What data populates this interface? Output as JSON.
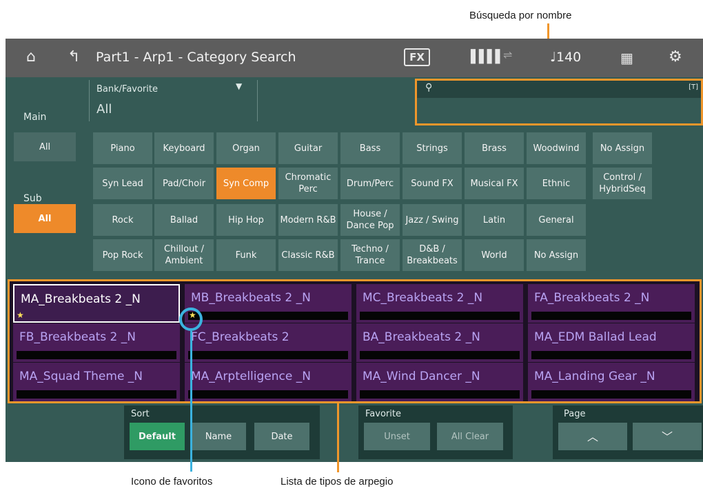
{
  "header": {
    "title": "Part1 - Arp1 - Category Search",
    "fx_label": "FX",
    "tempo_label": "♩140",
    "home_icon": "home-icon",
    "back_icon": "back-arrow-icon"
  },
  "bank": {
    "label": "Bank/Favorite",
    "value": "All"
  },
  "search": {
    "icon": "search-icon",
    "keyboard_indicator": "[T]",
    "value": ""
  },
  "main": {
    "label": "Main",
    "all_label": "All",
    "categories": [
      "Piano",
      "Keyboard",
      "Organ",
      "Guitar",
      "Bass",
      "Strings",
      "Brass",
      "Woodwind",
      "No Assign",
      "Syn Lead",
      "Pad/Choir",
      "Syn Comp",
      "Chromatic Perc",
      "Drum/Perc",
      "Sound FX",
      "Musical FX",
      "Ethnic",
      "Control / HybridSeq"
    ]
  },
  "sub": {
    "label": "Sub",
    "all_label": "All",
    "categories": [
      "Rock",
      "Ballad",
      "Hip Hop",
      "Modern R&B",
      "House / Dance Pop",
      "Jazz / Swing",
      "Latin",
      "General",
      "Pop Rock",
      "Chillout / Ambient",
      "Funk",
      "Classic R&B",
      "Techno / Trance",
      "D&B / Breakbeats",
      "World",
      "No Assign"
    ]
  },
  "arp_list": [
    "MA_Breakbeats 2 _N",
    "MB_Breakbeats 2 _N",
    "MC_Breakbeats 2 _N",
    "FA_Breakbeats 2 _N",
    "FB_Breakbeats 2 _N",
    "FC_Breakbeats 2",
    "BA_Breakbeats 2 _N",
    "MA_EDM Ballad Lead",
    "MA_Squad Theme _N",
    "MA_Arptelligence _N",
    "MA_Wind Dancer _N",
    "MA_Landing Gear _N"
  ],
  "sort": {
    "label": "Sort",
    "default_label": "Default",
    "name_label": "Name",
    "date_label": "Date"
  },
  "favorite": {
    "label": "Favorite",
    "unset_label": "Unset",
    "clear_label": "All Clear"
  },
  "page": {
    "label": "Page",
    "up_label": "︿",
    "down_label": "﹀"
  },
  "annotations": {
    "search": "Búsqueda por nombre",
    "favorite_icon": "Icono de favoritos",
    "arp_list": "Lista de tipos de arpegio"
  },
  "colors": {
    "accent": "#ee8a2a",
    "highlight": "#f0962b",
    "panel": "#355a55",
    "list_bg": "#1c1124",
    "list_text": "#b9a4f3"
  }
}
